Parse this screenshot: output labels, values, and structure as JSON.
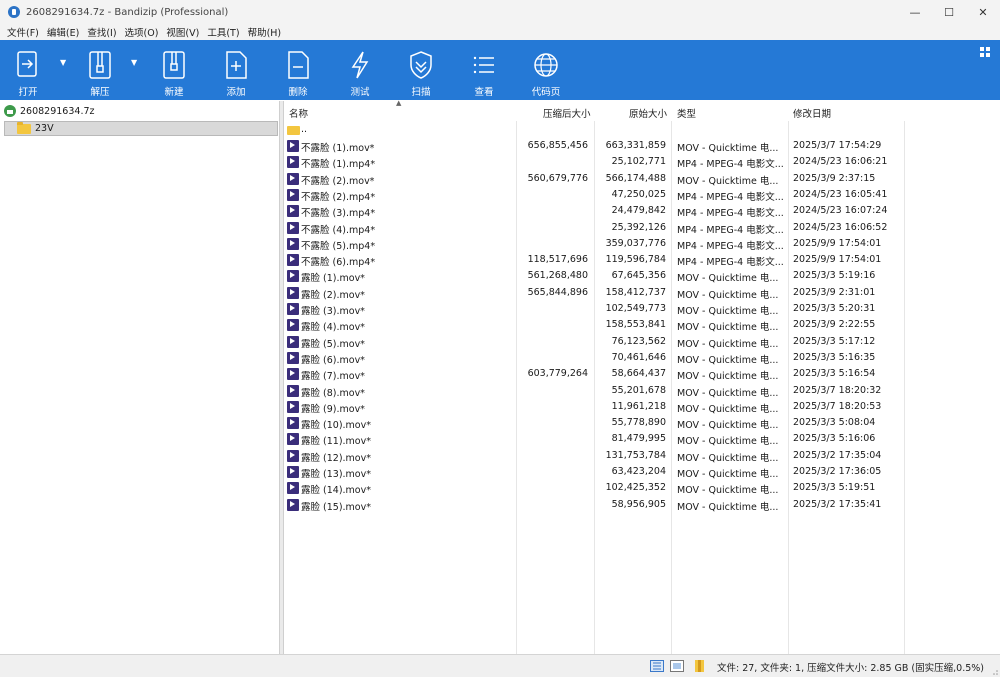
{
  "window": {
    "title": "2608291634.7z - Bandizip (Professional)",
    "controls": {
      "minimize": "—",
      "maximize": "☐",
      "close": "✕"
    }
  },
  "menu": [
    "文件(F)",
    "编辑(E)",
    "查找(I)",
    "选项(O)",
    "视图(V)",
    "工具(T)",
    "帮助(H)"
  ],
  "toolbar": {
    "open_label": "打开",
    "extract_label": "解压",
    "new_label": "新建",
    "add_label": "添加",
    "delete_label": "删除",
    "test_label": "测试",
    "scan_label": "扫描",
    "view_label": "查看",
    "codepage_label": "代码页",
    "colors": {
      "background": "#2579d6",
      "foreground": "#ffffff"
    }
  },
  "tree": {
    "root": "2608291634.7z",
    "folder": "23V"
  },
  "columns": {
    "name": "名称",
    "compressed": "压缩后大小",
    "original": "原始大小",
    "type": "类型",
    "modified": "修改日期"
  },
  "up_entry": "..",
  "files": [
    {
      "name": "不露脸 (1).mov*",
      "compressed": "656,855,456",
      "original": "663,331,859",
      "type": "MOV - Quicktime 电...",
      "modified": "2025/3/7 17:54:29"
    },
    {
      "name": "不露脸 (1).mp4*",
      "compressed": "",
      "original": "25,102,771",
      "type": "MP4 - MPEG-4 电影文...",
      "modified": "2024/5/23 16:06:21"
    },
    {
      "name": "不露脸 (2).mov*",
      "compressed": "560,679,776",
      "original": "566,174,488",
      "type": "MOV - Quicktime 电...",
      "modified": "2025/3/9 2:37:15"
    },
    {
      "name": "不露脸 (2).mp4*",
      "compressed": "",
      "original": "47,250,025",
      "type": "MP4 - MPEG-4 电影文...",
      "modified": "2024/5/23 16:05:41"
    },
    {
      "name": "不露脸 (3).mp4*",
      "compressed": "",
      "original": "24,479,842",
      "type": "MP4 - MPEG-4 电影文...",
      "modified": "2024/5/23 16:07:24"
    },
    {
      "name": "不露脸 (4).mp4*",
      "compressed": "",
      "original": "25,392,126",
      "type": "MP4 - MPEG-4 电影文...",
      "modified": "2024/5/23 16:06:52"
    },
    {
      "name": "不露脸 (5).mp4*",
      "compressed": "",
      "original": "359,037,776",
      "type": "MP4 - MPEG-4 电影文...",
      "modified": "2025/9/9 17:54:01"
    },
    {
      "name": "不露脸 (6).mp4*",
      "compressed": "118,517,696",
      "original": "119,596,784",
      "type": "MP4 - MPEG-4 电影文...",
      "modified": "2025/9/9 17:54:01"
    },
    {
      "name": "露脸 (1).mov*",
      "compressed": "561,268,480",
      "original": "67,645,356",
      "type": "MOV - Quicktime 电...",
      "modified": "2025/3/3 5:19:16"
    },
    {
      "name": "露脸 (2).mov*",
      "compressed": "565,844,896",
      "original": "158,412,737",
      "type": "MOV - Quicktime 电...",
      "modified": "2025/3/9 2:31:01"
    },
    {
      "name": "露脸 (3).mov*",
      "compressed": "",
      "original": "102,549,773",
      "type": "MOV - Quicktime 电...",
      "modified": "2025/3/3 5:20:31"
    },
    {
      "name": "露脸 (4).mov*",
      "compressed": "",
      "original": "158,553,841",
      "type": "MOV - Quicktime 电...",
      "modified": "2025/3/9 2:22:55"
    },
    {
      "name": "露脸 (5).mov*",
      "compressed": "",
      "original": "76,123,562",
      "type": "MOV - Quicktime 电...",
      "modified": "2025/3/3 5:17:12"
    },
    {
      "name": "露脸 (6).mov*",
      "compressed": "",
      "original": "70,461,646",
      "type": "MOV - Quicktime 电...",
      "modified": "2025/3/3 5:16:35"
    },
    {
      "name": "露脸 (7).mov*",
      "compressed": "603,779,264",
      "original": "58,664,437",
      "type": "MOV - Quicktime 电...",
      "modified": "2025/3/3 5:16:54"
    },
    {
      "name": "露脸 (8).mov*",
      "compressed": "",
      "original": "55,201,678",
      "type": "MOV - Quicktime 电...",
      "modified": "2025/3/7 18:20:32"
    },
    {
      "name": "露脸 (9).mov*",
      "compressed": "",
      "original": "11,961,218",
      "type": "MOV - Quicktime 电...",
      "modified": "2025/3/7 18:20:53"
    },
    {
      "name": "露脸 (10).mov*",
      "compressed": "",
      "original": "55,778,890",
      "type": "MOV - Quicktime 电...",
      "modified": "2025/3/3 5:08:04"
    },
    {
      "name": "露脸 (11).mov*",
      "compressed": "",
      "original": "81,479,995",
      "type": "MOV - Quicktime 电...",
      "modified": "2025/3/3 5:16:06"
    },
    {
      "name": "露脸 (12).mov*",
      "compressed": "",
      "original": "131,753,784",
      "type": "MOV - Quicktime 电...",
      "modified": "2025/3/2 17:35:04"
    },
    {
      "name": "露脸 (13).mov*",
      "compressed": "",
      "original": "63,423,204",
      "type": "MOV - Quicktime 电...",
      "modified": "2025/3/2 17:36:05"
    },
    {
      "name": "露脸 (14).mov*",
      "compressed": "",
      "original": "102,425,352",
      "type": "MOV - Quicktime 电...",
      "modified": "2025/3/3 5:19:51"
    },
    {
      "name": "露脸 (15).mov*",
      "compressed": "",
      "original": "58,956,905",
      "type": "MOV - Quicktime 电...",
      "modified": "2025/3/2 17:35:41"
    }
  ],
  "status": {
    "text": "文件: 27, 文件夹: 1, 压缩文件大小: 2.85 GB (固实压缩,0.5%)"
  }
}
